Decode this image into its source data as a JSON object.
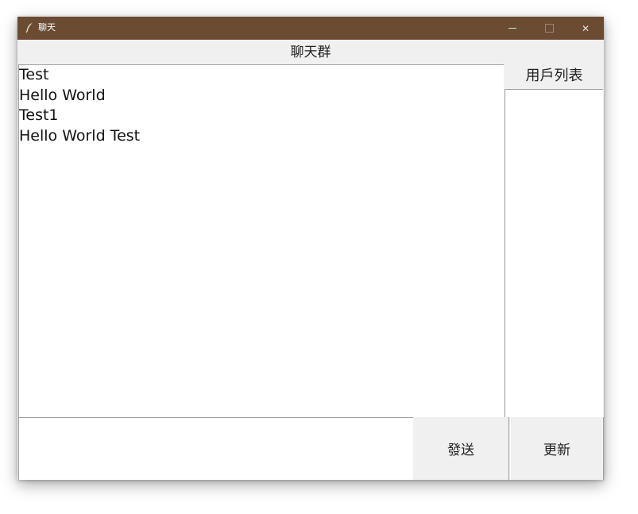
{
  "window": {
    "title": "聊天",
    "controls": {
      "close_glyph": "✕"
    }
  },
  "header": {
    "title": "聊天群"
  },
  "chat": {
    "messages": [
      "Test",
      "Hello World",
      "Test1",
      "Hello World Test"
    ]
  },
  "users": {
    "header": "用戶列表",
    "items": []
  },
  "composer": {
    "value": "",
    "send_label": "發送",
    "refresh_label": "更新"
  },
  "colors": {
    "titlebar": "#6b4c33",
    "window_bg": "#f0f0f0",
    "panel_bg": "#ffffff"
  },
  "icons": {
    "app": "feather-icon",
    "minimize": "minimize-icon",
    "maximize": "maximize-icon",
    "close": "close-icon"
  }
}
